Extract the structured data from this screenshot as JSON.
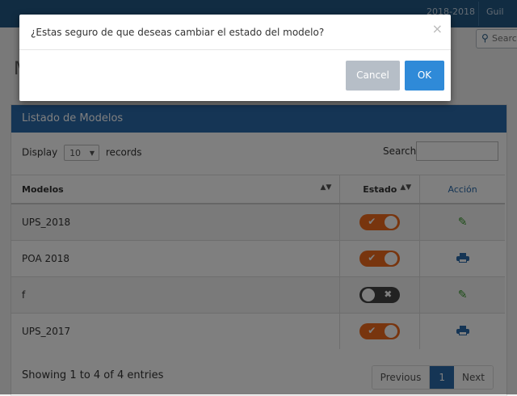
{
  "topbar": {
    "year": "2018-2018",
    "user": "Guil"
  },
  "search_top": {
    "placeholder": "Searc",
    "icon": "search-icon"
  },
  "page_heading": "M",
  "panel": {
    "title": "Listado de Modelos",
    "display_label": "Display",
    "length_value": "10",
    "records_label": "records",
    "search_label": "Search:"
  },
  "table": {
    "headers": [
      "Modelos",
      "Estado",
      "Acción"
    ],
    "rows": [
      {
        "name": "UPS_2018",
        "estado": true,
        "accion": "pencil-icon"
      },
      {
        "name": "POA 2018",
        "estado": true,
        "accion": "printer-icon"
      },
      {
        "name": "f",
        "estado": false,
        "accion": "pencil-icon"
      },
      {
        "name": "UPS_2017",
        "estado": true,
        "accion": "printer-icon"
      }
    ]
  },
  "footer": {
    "showing": "Showing 1 to 4 of 4 entries",
    "previous": "Previous",
    "page": "1",
    "next": "Next"
  },
  "modal": {
    "message": "¿Estas seguro de que deseas cambiar el estado del modelo?",
    "close": "×",
    "cancel_label": "Cancel",
    "ok_label": "OK"
  },
  "colors": {
    "header_blue": "#2a6aaa",
    "toggle_on": "#f06a1d",
    "toggle_off": "#444444",
    "ok_button": "#2f8ad8",
    "cancel_button": "#b6bec7"
  }
}
